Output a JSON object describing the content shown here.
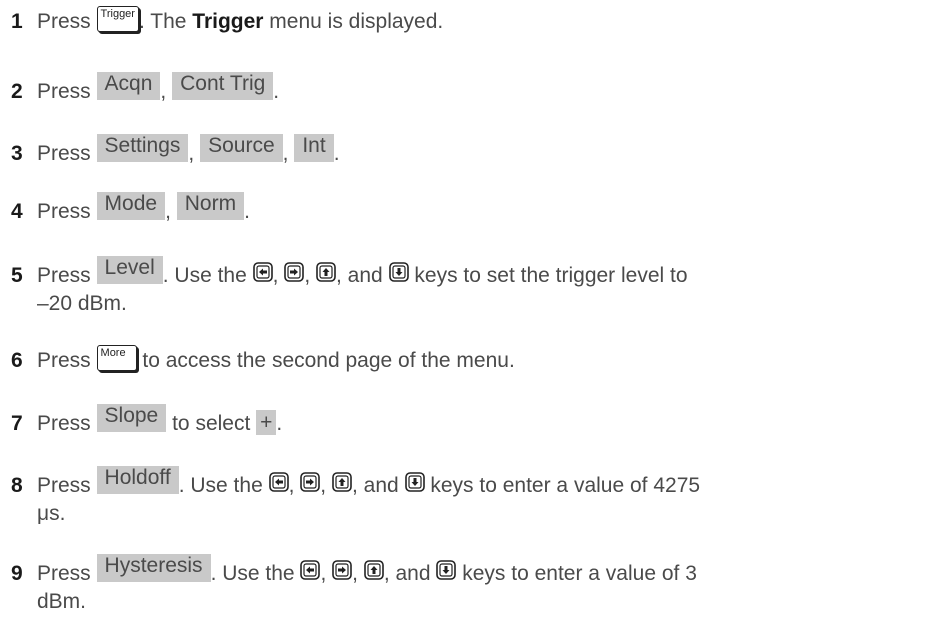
{
  "steps": [
    {
      "num": "1",
      "press": "Press",
      "key": "Trigger",
      "t1": ". The ",
      "bold": "Trigger",
      "t2": " menu is displayed."
    },
    {
      "num": "2",
      "press": "Press",
      "k1": "Acqn",
      "sep": ",",
      "k2": "Cont Trig",
      "end": "."
    },
    {
      "num": "3",
      "press": "Press",
      "k1": "Settings",
      "sep1": ",",
      "k2": "Source",
      "sep2": ",",
      "k3": "Int",
      "end": "."
    },
    {
      "num": "4",
      "press": "Press",
      "k1": "Mode",
      "sep": ",",
      "k2": "Norm",
      "end": "."
    },
    {
      "num": "5",
      "press": "Press",
      "k1": "Level",
      "t1": ". Use the",
      "c1": ",",
      "c2": ",",
      "t2": ", and",
      "t3": "keys to set the trigger level to",
      "line2": "–20 dBm."
    },
    {
      "num": "6",
      "press": "Press",
      "key": "More",
      "t1": "to access the second page of the menu."
    },
    {
      "num": "7",
      "press": "Press",
      "k1": "Slope",
      "t1": "to select",
      "sym": "+",
      "end": "."
    },
    {
      "num": "8",
      "press": "Press",
      "k1": "Holdoff",
      "t1": ". Use the",
      "c1": ",",
      "c2": ",",
      "t2": ", and",
      "t3": "keys to enter a value of 4275",
      "line2": "μs."
    },
    {
      "num": "9",
      "press": "Press",
      "k1": "Hysteresis",
      "t1": ". Use the",
      "c1": ",",
      "c2": ",",
      "t2": ", and",
      "t3": "keys to enter a value of 3",
      "line2": "dBm."
    }
  ],
  "icons": {
    "left": "left-arrow-key-icon",
    "right": "right-arrow-key-icon",
    "up": "up-arrow-key-icon",
    "down": "down-arrow-key-icon"
  }
}
